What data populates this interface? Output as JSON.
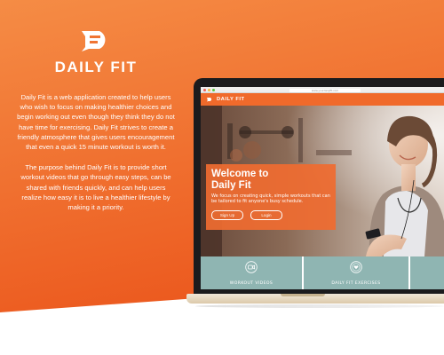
{
  "brand": {
    "logo_icon": "daily-fit-logo-icon",
    "name": "DAILY FIT",
    "accent_color": "#f06a2b",
    "gradient_top": "#f58a44",
    "gradient_bottom": "#ee5f22"
  },
  "description": {
    "paragraph_1": "Daily Fit is a web application created to help users who wish to focus on making healthier choices and begin working out even though they think they do not have time for exercising. Daily Fit strives to create a friendly atmosphere that gives users encouragement that even a quick 15 minute workout is worth it.",
    "paragraph_2": "The purpose behind Daily Fit is to provide short workout videos that go through easy steps, can be shared with friends quickly, and can help users realize how easy it is to live a healthier lifestyle by making it a priority."
  },
  "website": {
    "url": "www.yourdailyfit.com",
    "header_brand": "DAILY FIT",
    "hero": {
      "title_line_1": "Welcome to",
      "title_line_2": "Daily Fit",
      "subtitle": "We focus on creating quick, simple workouts that can be tailored to fit anyone's busy schedule.",
      "signup_label": "Sign Up",
      "login_label": "Login"
    },
    "features": [
      {
        "label": "WORKOUT VIDEOS",
        "icon": "video-camera-icon"
      },
      {
        "label": "DAILY FIT EXERCISES",
        "icon": "heart-badge-icon"
      },
      {
        "label": "",
        "icon": ""
      }
    ],
    "feature_color": "#8fb5b2"
  }
}
